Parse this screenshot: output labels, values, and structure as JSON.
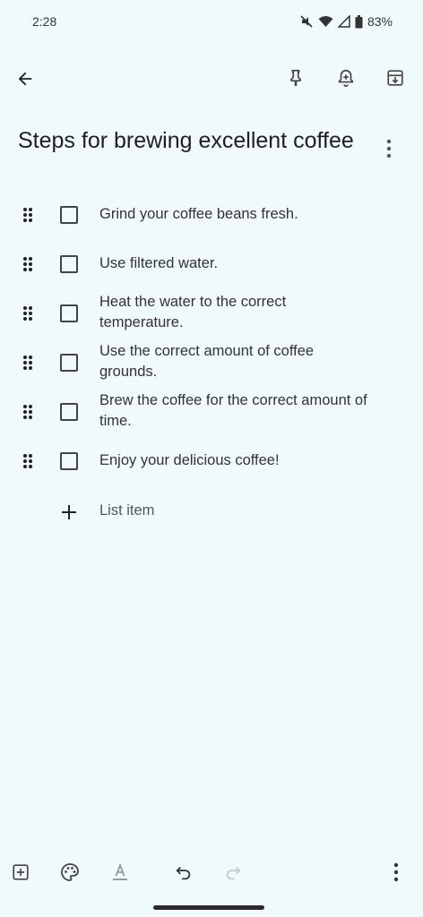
{
  "status_bar": {
    "time": "2:28",
    "battery": "83%"
  },
  "note": {
    "title": "Steps for brewing excellent coffee",
    "items": [
      {
        "text": "Grind your coffee beans fresh.",
        "checked": false
      },
      {
        "text": "Use filtered water.",
        "checked": false
      },
      {
        "text": "Heat the water to the correct temperature.",
        "checked": false
      },
      {
        "text": "Use the correct amount of coffee grounds.",
        "checked": false
      },
      {
        "text": "Brew the coffee for the correct amount of time.",
        "checked": false
      },
      {
        "text": "Enjoy your delicious coffee!",
        "checked": false
      }
    ],
    "add_item_label": "List item"
  },
  "icons": {
    "back": "arrow-left-icon",
    "pin": "pin-icon",
    "reminder": "bell-plus-icon",
    "archive": "archive-icon",
    "more": "more-vert-icon",
    "drag": "drag-handle-icon",
    "add": "plus-icon",
    "add_box": "add-box-icon",
    "palette": "palette-icon",
    "text_format": "text-format-icon",
    "undo": "undo-icon",
    "redo": "redo-icon"
  },
  "colors": {
    "background": "#f0fafa",
    "text": "#1f1f1f",
    "icon": "#444444"
  }
}
